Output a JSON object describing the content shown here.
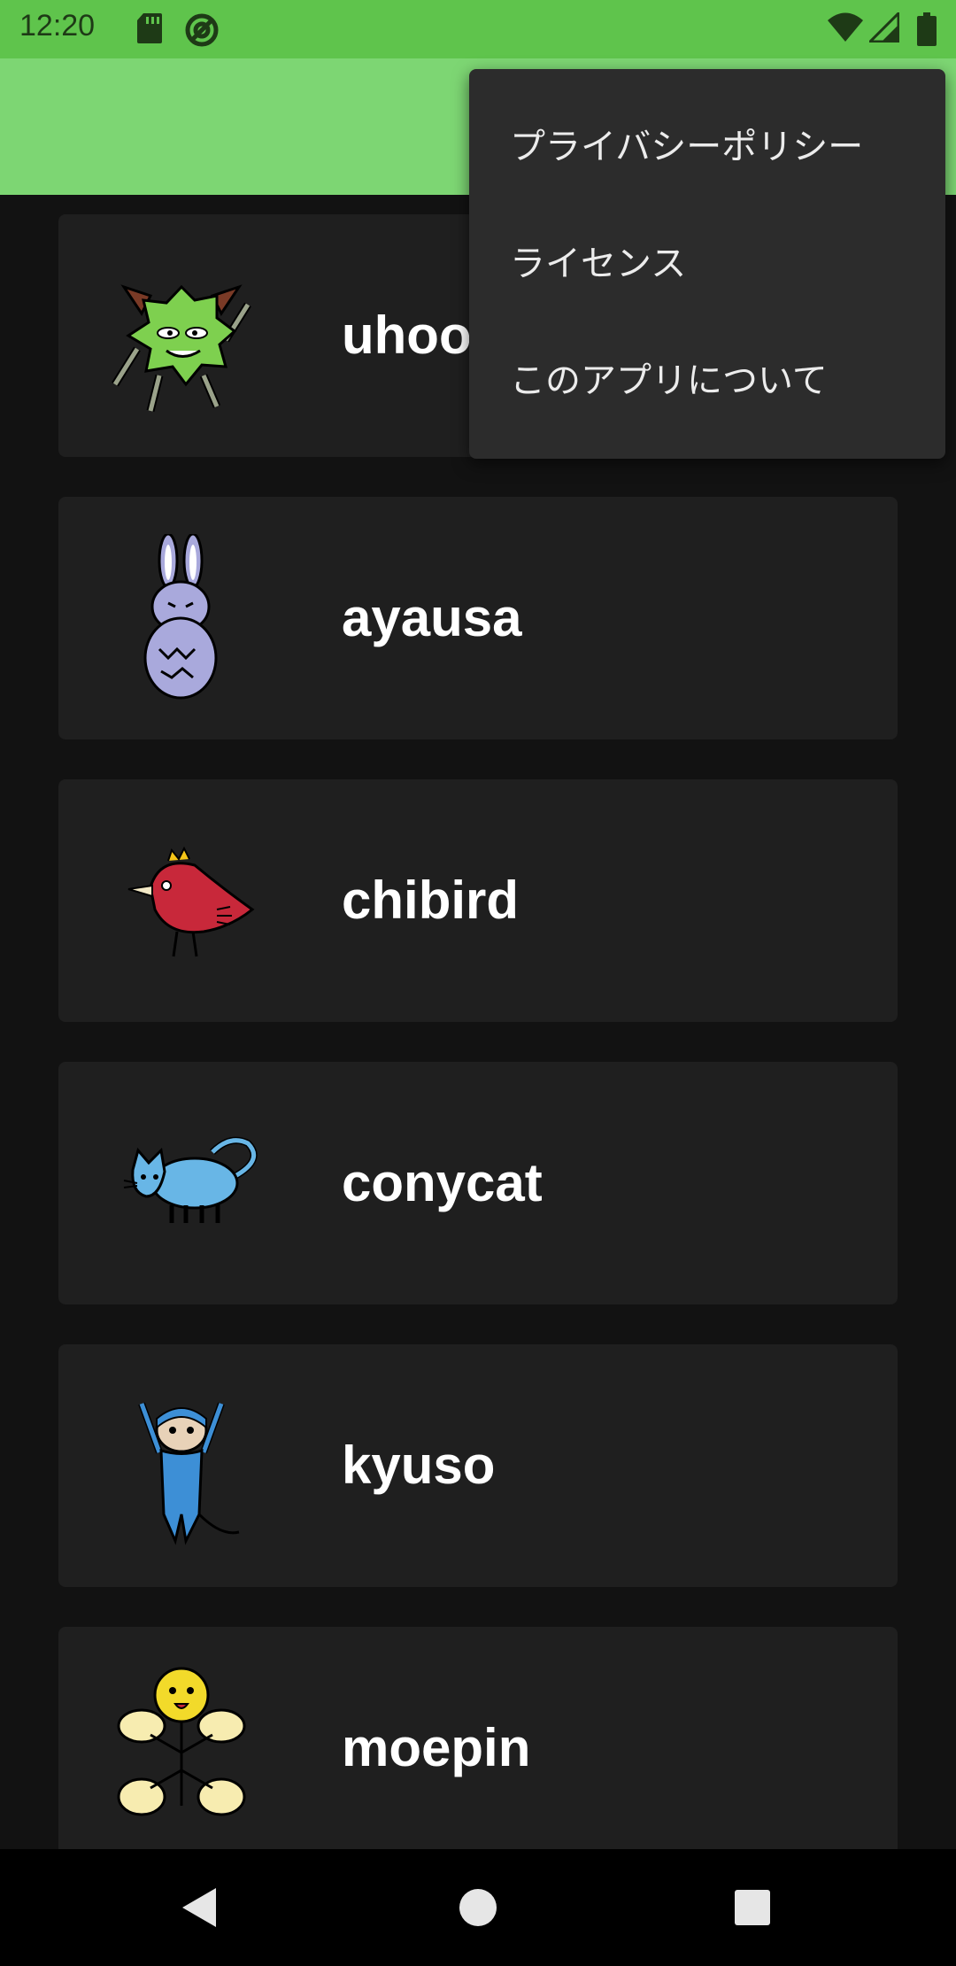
{
  "status_bar": {
    "time": "12:20",
    "icons": [
      "sd-card-icon",
      "at-sign-icon",
      "wifi-icon",
      "signal-icon",
      "battery-icon"
    ]
  },
  "colors": {
    "status_bar": "#5fc44c",
    "app_bar": "#7dd673",
    "background": "#121212",
    "card": "#1f1f1f",
    "menu": "#2c2c2c"
  },
  "list": {
    "items": [
      {
        "name": "uhoo",
        "icon": "green-monster-icon"
      },
      {
        "name": "ayausa",
        "icon": "purple-rabbit-icon"
      },
      {
        "name": "chibird",
        "icon": "red-bird-icon"
      },
      {
        "name": "conycat",
        "icon": "blue-cat-icon"
      },
      {
        "name": "kyuso",
        "icon": "blue-mouse-icon"
      },
      {
        "name": "moepin",
        "icon": "yellow-bug-icon"
      }
    ]
  },
  "menu": {
    "items": [
      "プライバシーポリシー",
      "ライセンス",
      "このアプリについて"
    ]
  },
  "nav": {
    "icons": [
      "back-icon",
      "home-icon",
      "recents-icon"
    ]
  }
}
